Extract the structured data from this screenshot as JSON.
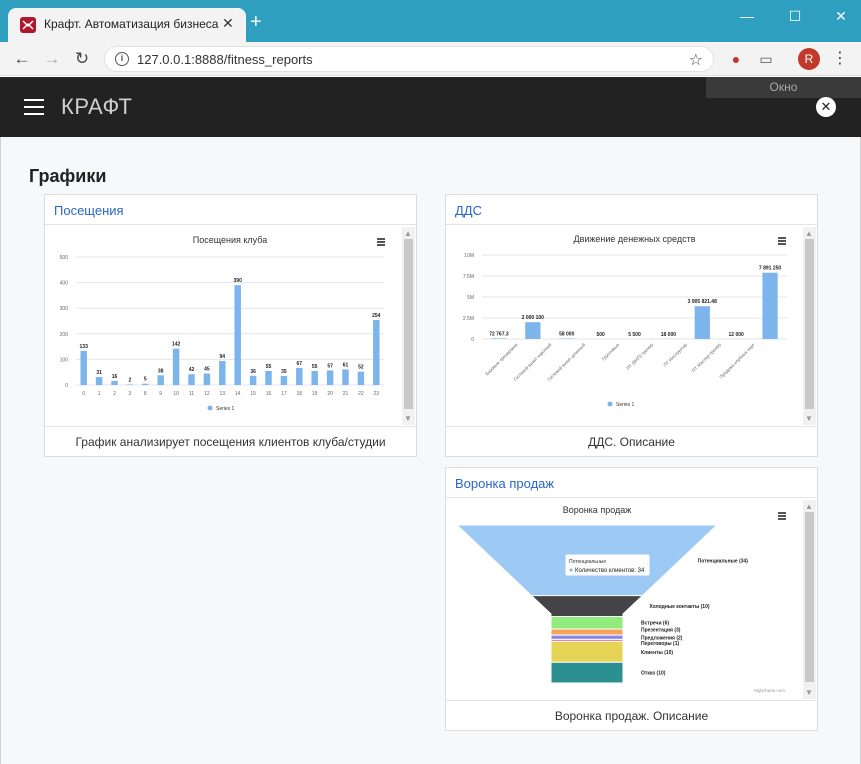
{
  "browser": {
    "tab_title": "Крафт. Автоматизация бизнеса",
    "url": "127.0.0.1:8888/fitness_reports",
    "avatar_letter": "R"
  },
  "app": {
    "brand": "КРАФТ",
    "window_label": "Окно"
  },
  "page": {
    "title": "Графики"
  },
  "cards": {
    "visits": {
      "title": "Посещения",
      "description": "График анализирует посещения клиентов клуба/студии"
    },
    "dds": {
      "title": "ДДС",
      "description": "ДДС. Описание"
    },
    "funnel": {
      "title": "Воронка продаж",
      "description": "Воронка продаж. Описание"
    }
  },
  "chart_data": [
    {
      "type": "bar",
      "title": "Посещения клуба",
      "categories": [
        "0",
        "1",
        "2",
        "3",
        "8",
        "9",
        "10",
        "11",
        "12",
        "13",
        "14",
        "15",
        "16",
        "17",
        "18",
        "19",
        "20",
        "21",
        "22",
        "23"
      ],
      "series": [
        {
          "name": "Series 1",
          "values": [
            133,
            31,
            16,
            2,
            5,
            38,
            142,
            42,
            45,
            94,
            390,
            36,
            55,
            35,
            67,
            55,
            57,
            61,
            52,
            254
          ]
        }
      ],
      "yticks": [
        "0",
        "100",
        "200",
        "300",
        "400",
        "500"
      ],
      "ylim": [
        0,
        500
      ],
      "legend": "bottom",
      "color": "#7cb5ec"
    },
    {
      "type": "bar",
      "title": "Движение денежных средств",
      "categories": [
        "Базовые тренировки",
        "Гостевой визит короткий",
        "Гостевой визит длинный",
        "Групповые",
        "ПТ (ВИП) тренер",
        "ПТ Инструктор",
        "ПТ Мастер-тренер",
        "Продажа клубных карт"
      ],
      "series": [
        {
          "name": "Series 1",
          "values": [
            72767.3,
            2000100,
            58000,
            500,
            5500,
            18000,
            3905821.48,
            12000,
            7891250
          ]
        }
      ],
      "labels": [
        "72 767.3",
        "2 000 100",
        "58 000",
        "500",
        "5 500",
        "18 000",
        "3 905 821.48",
        "12 000",
        "7 891 250"
      ],
      "yticks": [
        "0",
        "2.5M",
        "5M",
        "7.5M",
        "10M"
      ],
      "ylim": [
        0,
        10000000
      ],
      "legend": "bottom",
      "color": "#7cb5ec"
    },
    {
      "type": "funnel",
      "title": "Воронка продаж",
      "stages": [
        {
          "name": "Потенциальные",
          "label": "Потенциальные (34)",
          "value": 34,
          "color": "#9ccaf5"
        },
        {
          "name": "Холодные контакты",
          "label": "Холодные контакты (10)",
          "value": 10,
          "color": "#434348"
        },
        {
          "name": "Встречи",
          "label": "Встречи (6)",
          "value": 6,
          "color": "#90ed7d"
        },
        {
          "name": "Презентация",
          "label": "Презентация (3)",
          "value": 3,
          "color": "#f7a35c"
        },
        {
          "name": "Предложения",
          "label": "Предложения (2)",
          "value": 2,
          "color": "#8085e9"
        },
        {
          "name": "Переговоры",
          "label": "Переговоры (1)",
          "value": 1,
          "color": "#f15c80"
        },
        {
          "name": "Клиенты",
          "label": "Клиенты (10)",
          "value": 10,
          "color": "#e4d354"
        },
        {
          "name": "Отказ",
          "label": "Отказ (10)",
          "value": 10,
          "color": "#2b908f"
        }
      ],
      "tooltip": {
        "title": "Потенциальные",
        "text": "Количество клиентов: 34"
      },
      "credits": "Highcharts.com"
    }
  ]
}
